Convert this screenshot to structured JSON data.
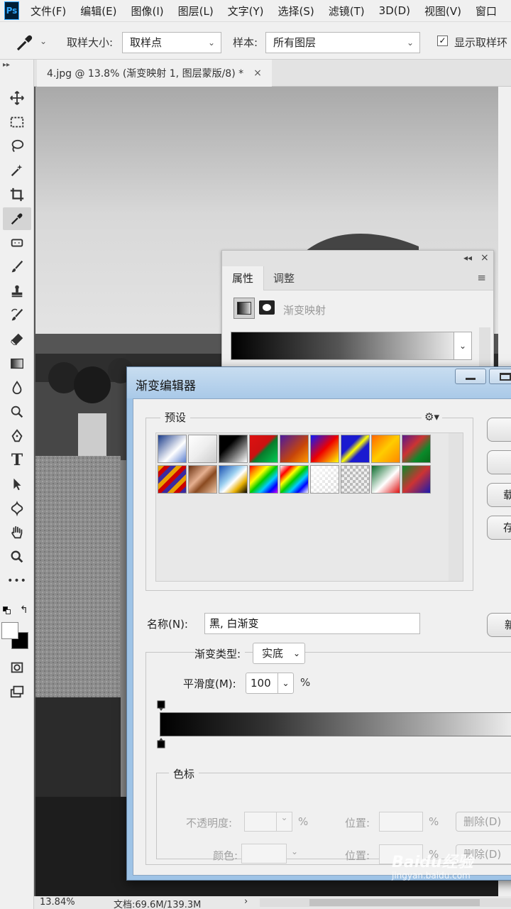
{
  "app": {
    "logo": "Ps"
  },
  "menu": [
    "文件(F)",
    "编辑(E)",
    "图像(I)",
    "图层(L)",
    "文字(Y)",
    "选择(S)",
    "滤镜(T)",
    "3D(D)",
    "视图(V)",
    "窗口"
  ],
  "options": {
    "sample_size_label": "取样大小:",
    "sample_size_value": "取样点",
    "sample_label": "样本:",
    "sample_value": "所有图层",
    "show_ring_label": "显示取样环",
    "show_ring_checked": true
  },
  "toolbar": {
    "tools": [
      "move-tool",
      "marquee-tool",
      "lasso-tool",
      "magic-wand-tool",
      "crop-tool",
      "eyedropper-tool",
      "healing-brush-tool",
      "brush-tool",
      "clone-stamp-tool",
      "history-brush-tool",
      "eraser-tool",
      "gradient-tool",
      "blur-tool",
      "dodge-tool",
      "pen-tool",
      "type-tool",
      "path-selection-tool",
      "shape-tool",
      "hand-tool",
      "zoom-tool",
      "more-tools"
    ],
    "active_tool": "eyedropper-tool",
    "type_tool_glyph": "T",
    "more_glyph": "•••"
  },
  "document_tab": {
    "title": "4.jpg @ 13.8% (渐变映射 1, 图层蒙版/8) *",
    "close": "×"
  },
  "status": {
    "zoom": "13.84%",
    "doc_size": "文档:69.6M/139.3M",
    "arrow": "›"
  },
  "properties_panel": {
    "collapse": "◂◂",
    "close": "×",
    "tabs": [
      "属性",
      "调整"
    ],
    "active_tab": "属性",
    "title": "渐变映射",
    "menu_icon": "≡"
  },
  "gradient_editor": {
    "title": "渐变编辑器",
    "presets_label": "预设",
    "gear": "⚙▾",
    "preset_count": 18,
    "side_buttons": [
      "",
      "",
      "载",
      "存"
    ],
    "name_label": "名称(N):",
    "name_value": "黑, 白渐变",
    "new_button": "新",
    "type_label": "渐变类型:",
    "type_value": "实底",
    "smoothness_label": "平滑度(M):",
    "smoothness_value": "100",
    "smoothness_unit": "%",
    "stops_label": "色标",
    "opacity_label": "不透明度:",
    "opacity_unit": "%",
    "position_label": "位置:",
    "position_unit": "%",
    "delete_label": "删除(D)",
    "color_label": "颜色:"
  },
  "watermark": {
    "brand": "Baidu经验",
    "url": "jingyan.baidu.com"
  }
}
